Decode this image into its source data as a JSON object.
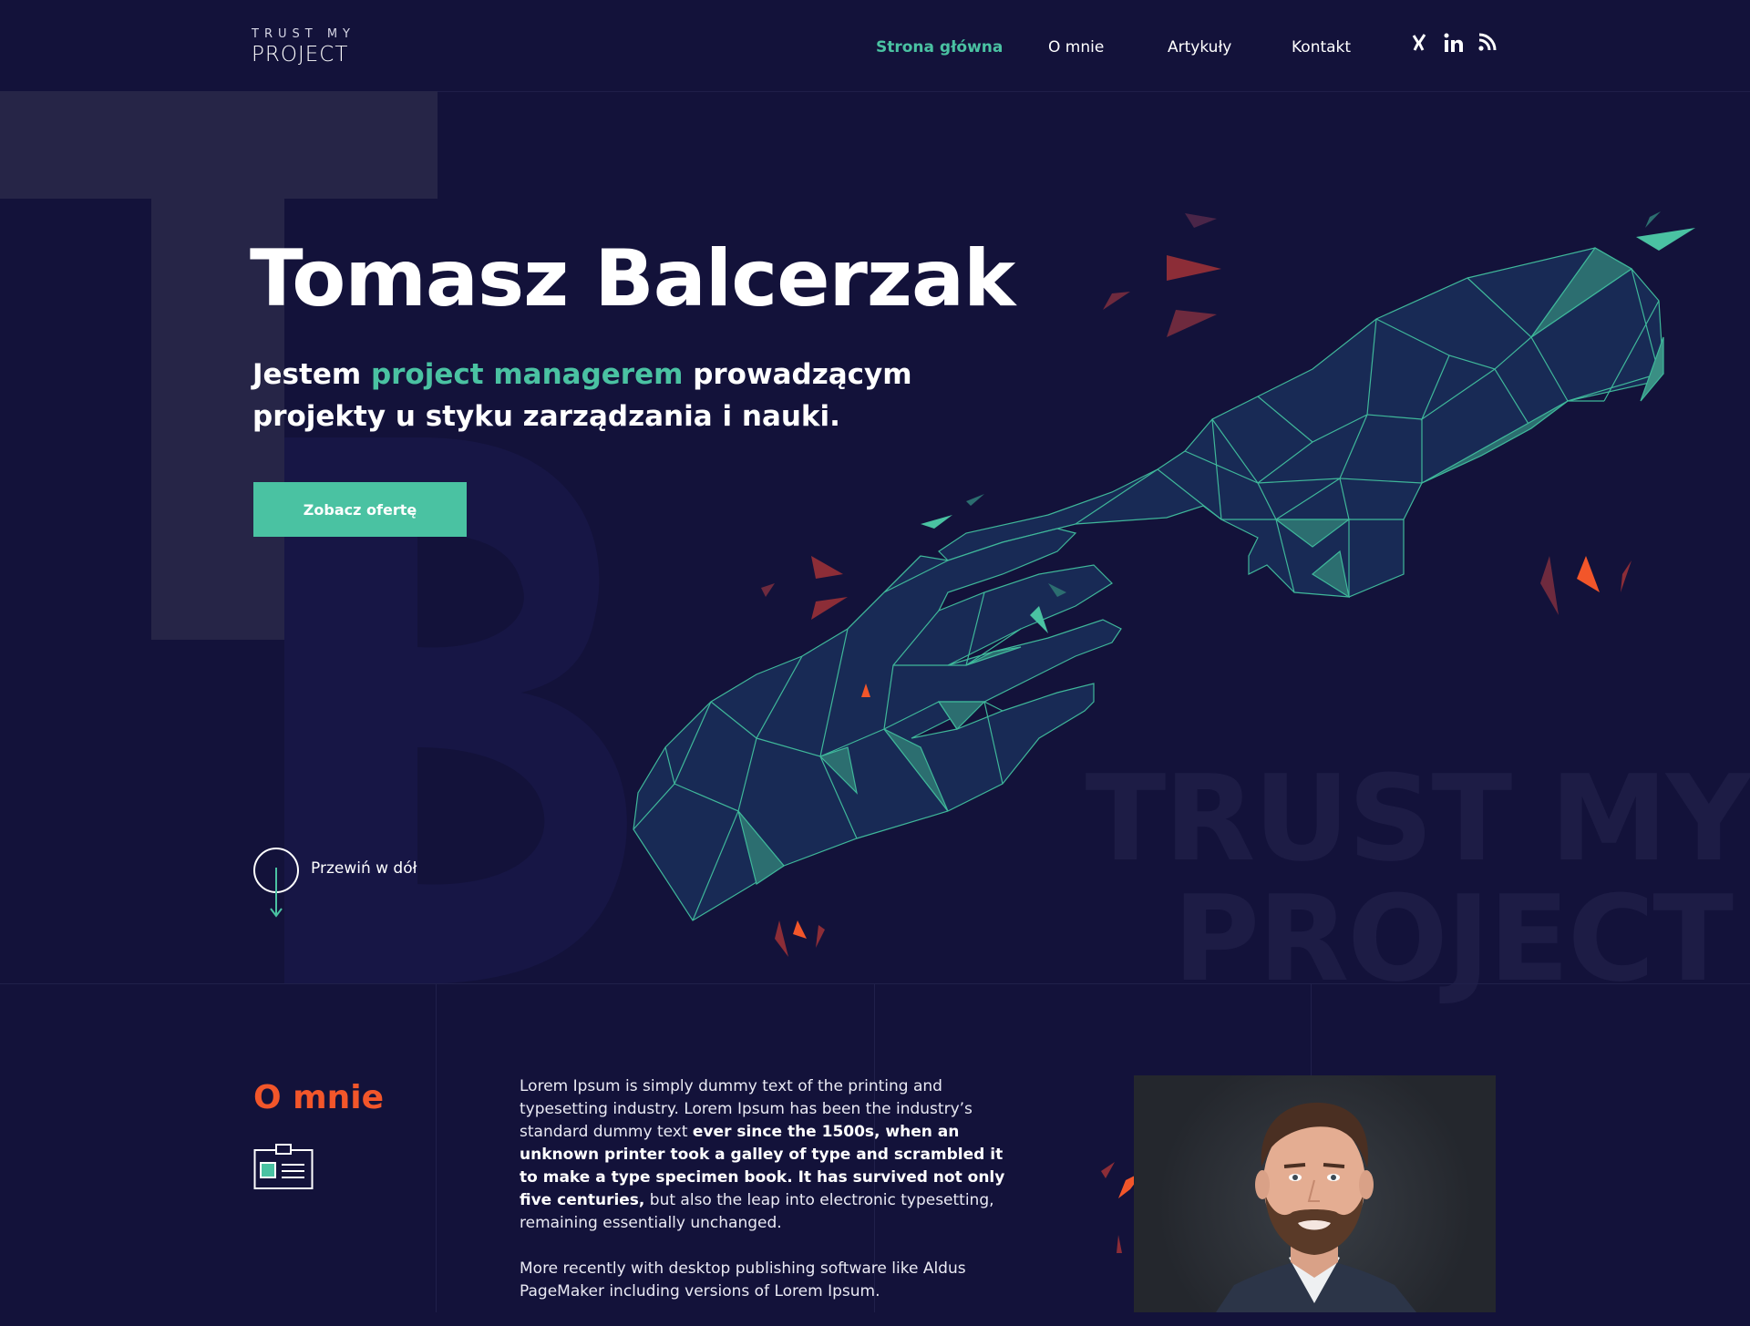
{
  "header": {
    "logo_top": "TRUST MY",
    "logo_bottom": "PROJECT",
    "nav": [
      {
        "label": "Strona główna",
        "active": true
      },
      {
        "label": "O mnie",
        "active": false
      },
      {
        "label": "Artykuły",
        "active": false
      },
      {
        "label": "Kontakt",
        "active": false
      }
    ],
    "social_icons": [
      "xing-icon",
      "linkedin-icon",
      "rss-icon"
    ]
  },
  "hero": {
    "title": "Tomasz Balcerzak",
    "subtitle_prefix": "Jestem ",
    "subtitle_accent": "project managerem",
    "subtitle_suffix": " prowadzącym projekty u styku zarządzania i nauki.",
    "cta_label": "Zobacz ofertę",
    "scroll_label": "Przewiń w dół",
    "watermark_line1": "TRUST MY",
    "watermark_line2": "PROJECT"
  },
  "about": {
    "title": "O mnie",
    "para1_start": "Lorem Ipsum is simply dummy text of the printing and typesetting industry. Lorem Ipsum has been the industry’s standard dummy text ",
    "para1_bold": "ever since the 1500s, when an unknown printer took a galley of type and scrambled it to make a type specimen book. It has survived not only five centuries,",
    "para1_end": " but also the leap into electronic typesetting, remaining essentially unchanged.",
    "para2": "More recently with desktop publishing software like Aldus PageMaker including versions of Lorem Ipsum."
  },
  "colors": {
    "background": "#13123a",
    "accent_teal": "#4ac2a2",
    "accent_orange": "#f2562a"
  }
}
